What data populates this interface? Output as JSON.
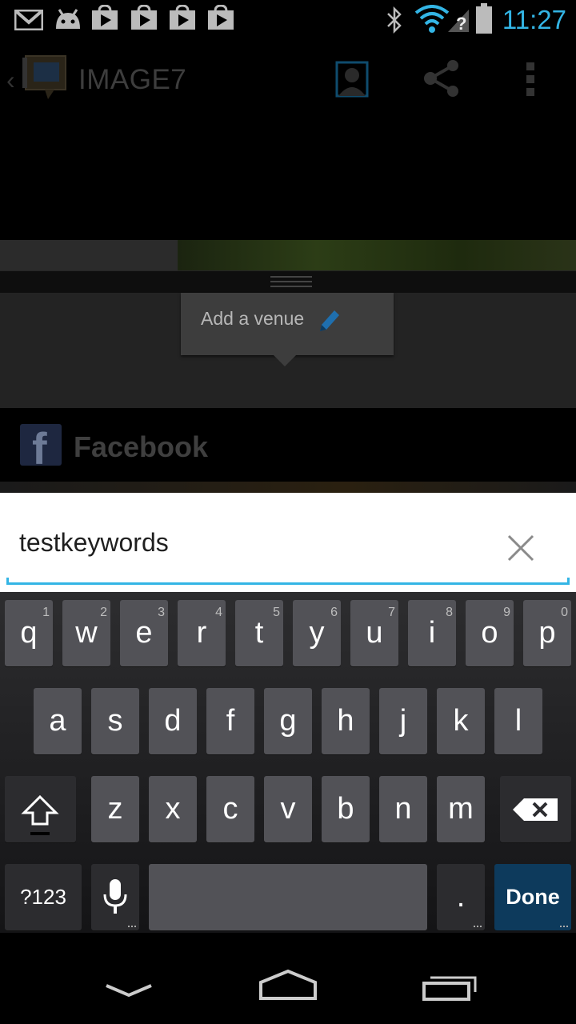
{
  "status_bar": {
    "time": "11:27",
    "icons": [
      "gmail-icon",
      "android-icon",
      "play-store-icon",
      "play-store-icon",
      "play-store-icon",
      "play-store-icon",
      "bluetooth-icon",
      "wifi-icon",
      "no-signal-icon",
      "battery-icon"
    ]
  },
  "action_bar": {
    "title": "IMAGE7",
    "actions": [
      "contact-icon",
      "share-icon",
      "overflow-menu-icon"
    ]
  },
  "venue": {
    "popup_label": "Add a venue"
  },
  "facebook": {
    "label": "Facebook",
    "logo_letter": "f"
  },
  "search": {
    "value": "testkeywords"
  },
  "keyboard": {
    "row1": [
      {
        "label": "q",
        "hint": "1"
      },
      {
        "label": "w",
        "hint": "2"
      },
      {
        "label": "e",
        "hint": "3"
      },
      {
        "label": "r",
        "hint": "4"
      },
      {
        "label": "t",
        "hint": "5"
      },
      {
        "label": "y",
        "hint": "6"
      },
      {
        "label": "u",
        "hint": "7"
      },
      {
        "label": "i",
        "hint": "8"
      },
      {
        "label": "o",
        "hint": "9"
      },
      {
        "label": "p",
        "hint": "0"
      }
    ],
    "row2": [
      "a",
      "s",
      "d",
      "f",
      "g",
      "h",
      "j",
      "k",
      "l"
    ],
    "row3": [
      "z",
      "x",
      "c",
      "v",
      "b",
      "n",
      "m"
    ],
    "symbols_label": "?123",
    "period_label": ".",
    "done_label": "Done"
  },
  "colors": {
    "accent": "#33b5e5",
    "done_key": "#0d3a5c"
  }
}
